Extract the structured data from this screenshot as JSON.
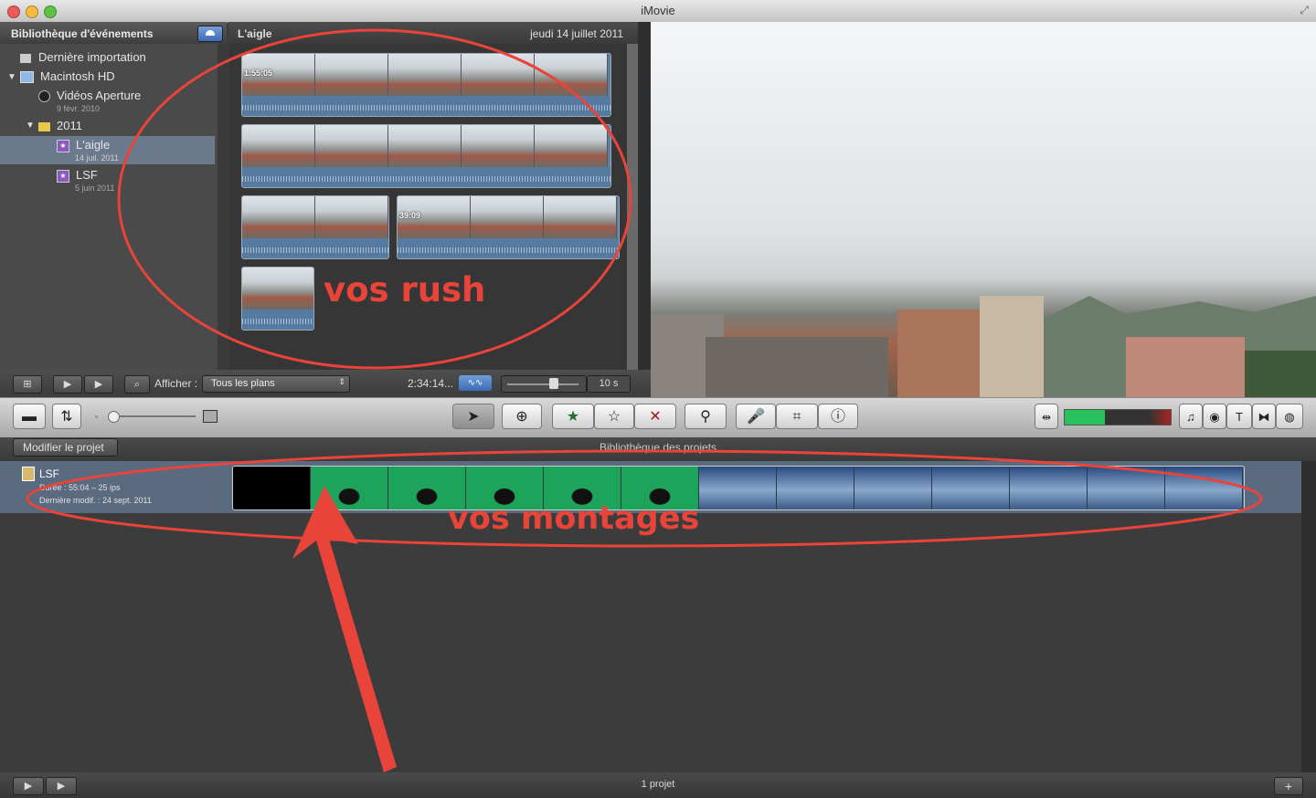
{
  "window": {
    "title": "iMovie"
  },
  "sidebar": {
    "header": "Bibliothèque d'événements",
    "items": [
      {
        "label": "Dernière importation"
      },
      {
        "label": "Macintosh HD"
      },
      {
        "label": "Vidéos Aperture",
        "sub": "9 févr. 2010"
      },
      {
        "label": "2011"
      },
      {
        "label": "L'aigle",
        "sub": "14 juil. 2011"
      },
      {
        "label": "LSF",
        "sub": "5 juin 2011"
      }
    ]
  },
  "browser": {
    "event_name": "L'aigle",
    "event_date": "jeudi 14 juillet 2011",
    "clip_durations": [
      "1:55:05",
      "39:09"
    ]
  },
  "browser_toolbar": {
    "show_label": "Afficher :",
    "filter_value": "Tous les plans",
    "total_duration": "2:34:14...",
    "thumb_length": "10 s"
  },
  "projects": {
    "edit_button": "Modifier le projet",
    "library_title": "Bibliothèque des projets",
    "project": {
      "name": "LSF",
      "duration": "Durée : 55:04 – 25 ips",
      "modified": "Dernière modif. : 24 sept. 2011"
    },
    "count": "1 projet"
  },
  "annotations": {
    "rush": "vos rush",
    "montages": "vos montages"
  },
  "colors": {
    "annotation": "#e8443a",
    "selection": "#5a6b80"
  }
}
